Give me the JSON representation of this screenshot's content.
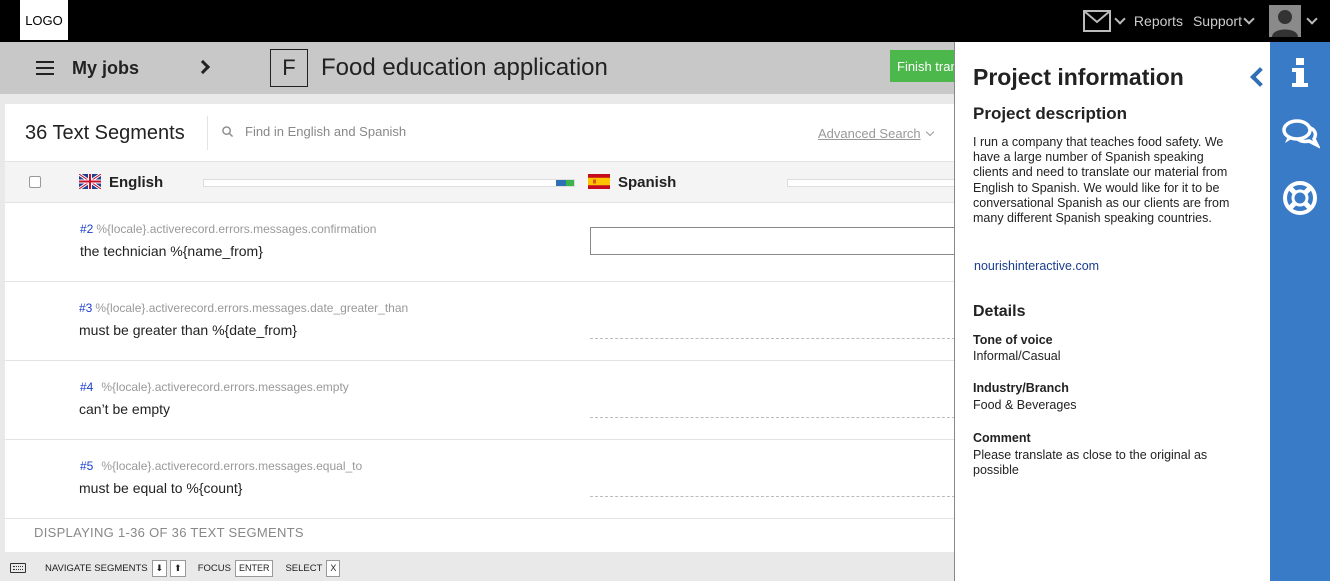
{
  "topbar": {
    "logo": "LOGO",
    "reports": "Reports",
    "support": "Support"
  },
  "titlebar": {
    "my_jobs": "My jobs",
    "project_initial": "F",
    "project_title": "Food education application",
    "finish_button": "Finish translation"
  },
  "segments_header": {
    "count_label": "36 Text Segments",
    "search_placeholder": "Find in English and Spanish",
    "advanced_search": "Advanced Search"
  },
  "languages": {
    "source": "English",
    "target": "Spanish",
    "source_progress": 1.0
  },
  "segments": [
    {
      "number": "#2",
      "key": "%{locale}.activerecord.errors.messages.confirmation",
      "text": "the technician %{name_from}"
    },
    {
      "number": "#3",
      "key": "%{locale}.activerecord.errors.messages.date_greater_than",
      "text": "must be greater than %{date_from}"
    },
    {
      "number": "#4",
      "key": "%{locale}.activerecord.errors.messages.empty",
      "text": "can’t be empty"
    },
    {
      "number": "#5",
      "key": "%{locale}.activerecord.errors.messages.equal_to",
      "text": "must be equal to %{count}"
    }
  ],
  "displaying": "DISPLAYING 1-36 OF 36 TEXT SEGMENTS",
  "shortcuts": {
    "navigate": "NAVIGATE SEGMENTS",
    "key_down": "⬇",
    "key_up": "⬆",
    "focus": "FOCUS",
    "key_enter": "ENTER",
    "select": "SELECT",
    "key_x": "X"
  },
  "info_panel": {
    "title": "Project information",
    "description_heading": "Project description",
    "description": "I run a company that teaches food safety. We have a large number of Spanish speaking clients and need to translate our material from English to Spanish.  We would like for it to be conversational Spanish as our clients are from many different Spanish speaking countries.",
    "website": "nourishinteractive.com",
    "details_heading": "Details",
    "tone_label": "Tone of voice",
    "tone_value": "Informal/Casual",
    "industry_label": "Industry/Branch",
    "industry_value": "Food & Beverages",
    "comment_label": "Comment",
    "comment_value": "Please translate as close to the original as possible"
  },
  "colors": {
    "sidebar": "#3a7bc8",
    "finish_button": "#4cb84c",
    "segment_number": "#1a3fd0"
  }
}
